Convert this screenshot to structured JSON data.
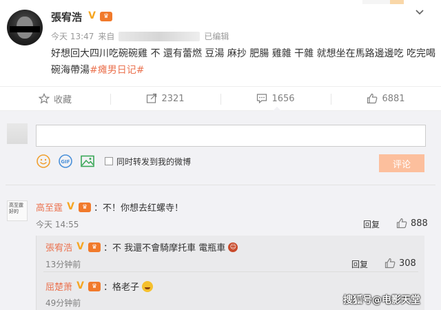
{
  "post": {
    "author": "張宥浩",
    "time": "今天 13:47",
    "source_prefix": "来自",
    "edited": "已编辑",
    "text": "好想回大四川吃碗碗雞 不 還有蕾燃 豆湯 麻抄 肥腸 雞雜 干雜 就想坐在馬路邊邊吃 吃完喝碗海帶湯",
    "topic": "#瘫男日记#"
  },
  "actions": {
    "collect": "收藏",
    "repost": "2321",
    "comment": "1656",
    "like": "6881"
  },
  "composer": {
    "placeholder": "",
    "forward_label": "同时转发到我的微博",
    "submit_label": "评论"
  },
  "comments": [
    {
      "name": "高至霆",
      "text": "：不！你想去红螺寺！",
      "time": "今天 14:55",
      "reply": "回复",
      "likes": "888",
      "avatar_text": "高至霆 好的"
    }
  ],
  "sub_comments": [
    {
      "name": "張宥浩",
      "text": "：不 我還不會騎摩托車 電瓶車",
      "time": "13分钟前",
      "reply": "回复",
      "likes": "308"
    },
    {
      "name": "屈楚萧",
      "text": "：格老子",
      "time": "49分钟前"
    }
  ],
  "watermark": "搜狐号@电影天堂",
  "icons": {
    "verified": "verified-badge-icon",
    "crown": "vip-crown-icon",
    "chevron": "chevron-down-icon"
  },
  "colors": {
    "accent": "#eb7350",
    "badge": "#f5a623",
    "button": "#fcbf9d"
  }
}
